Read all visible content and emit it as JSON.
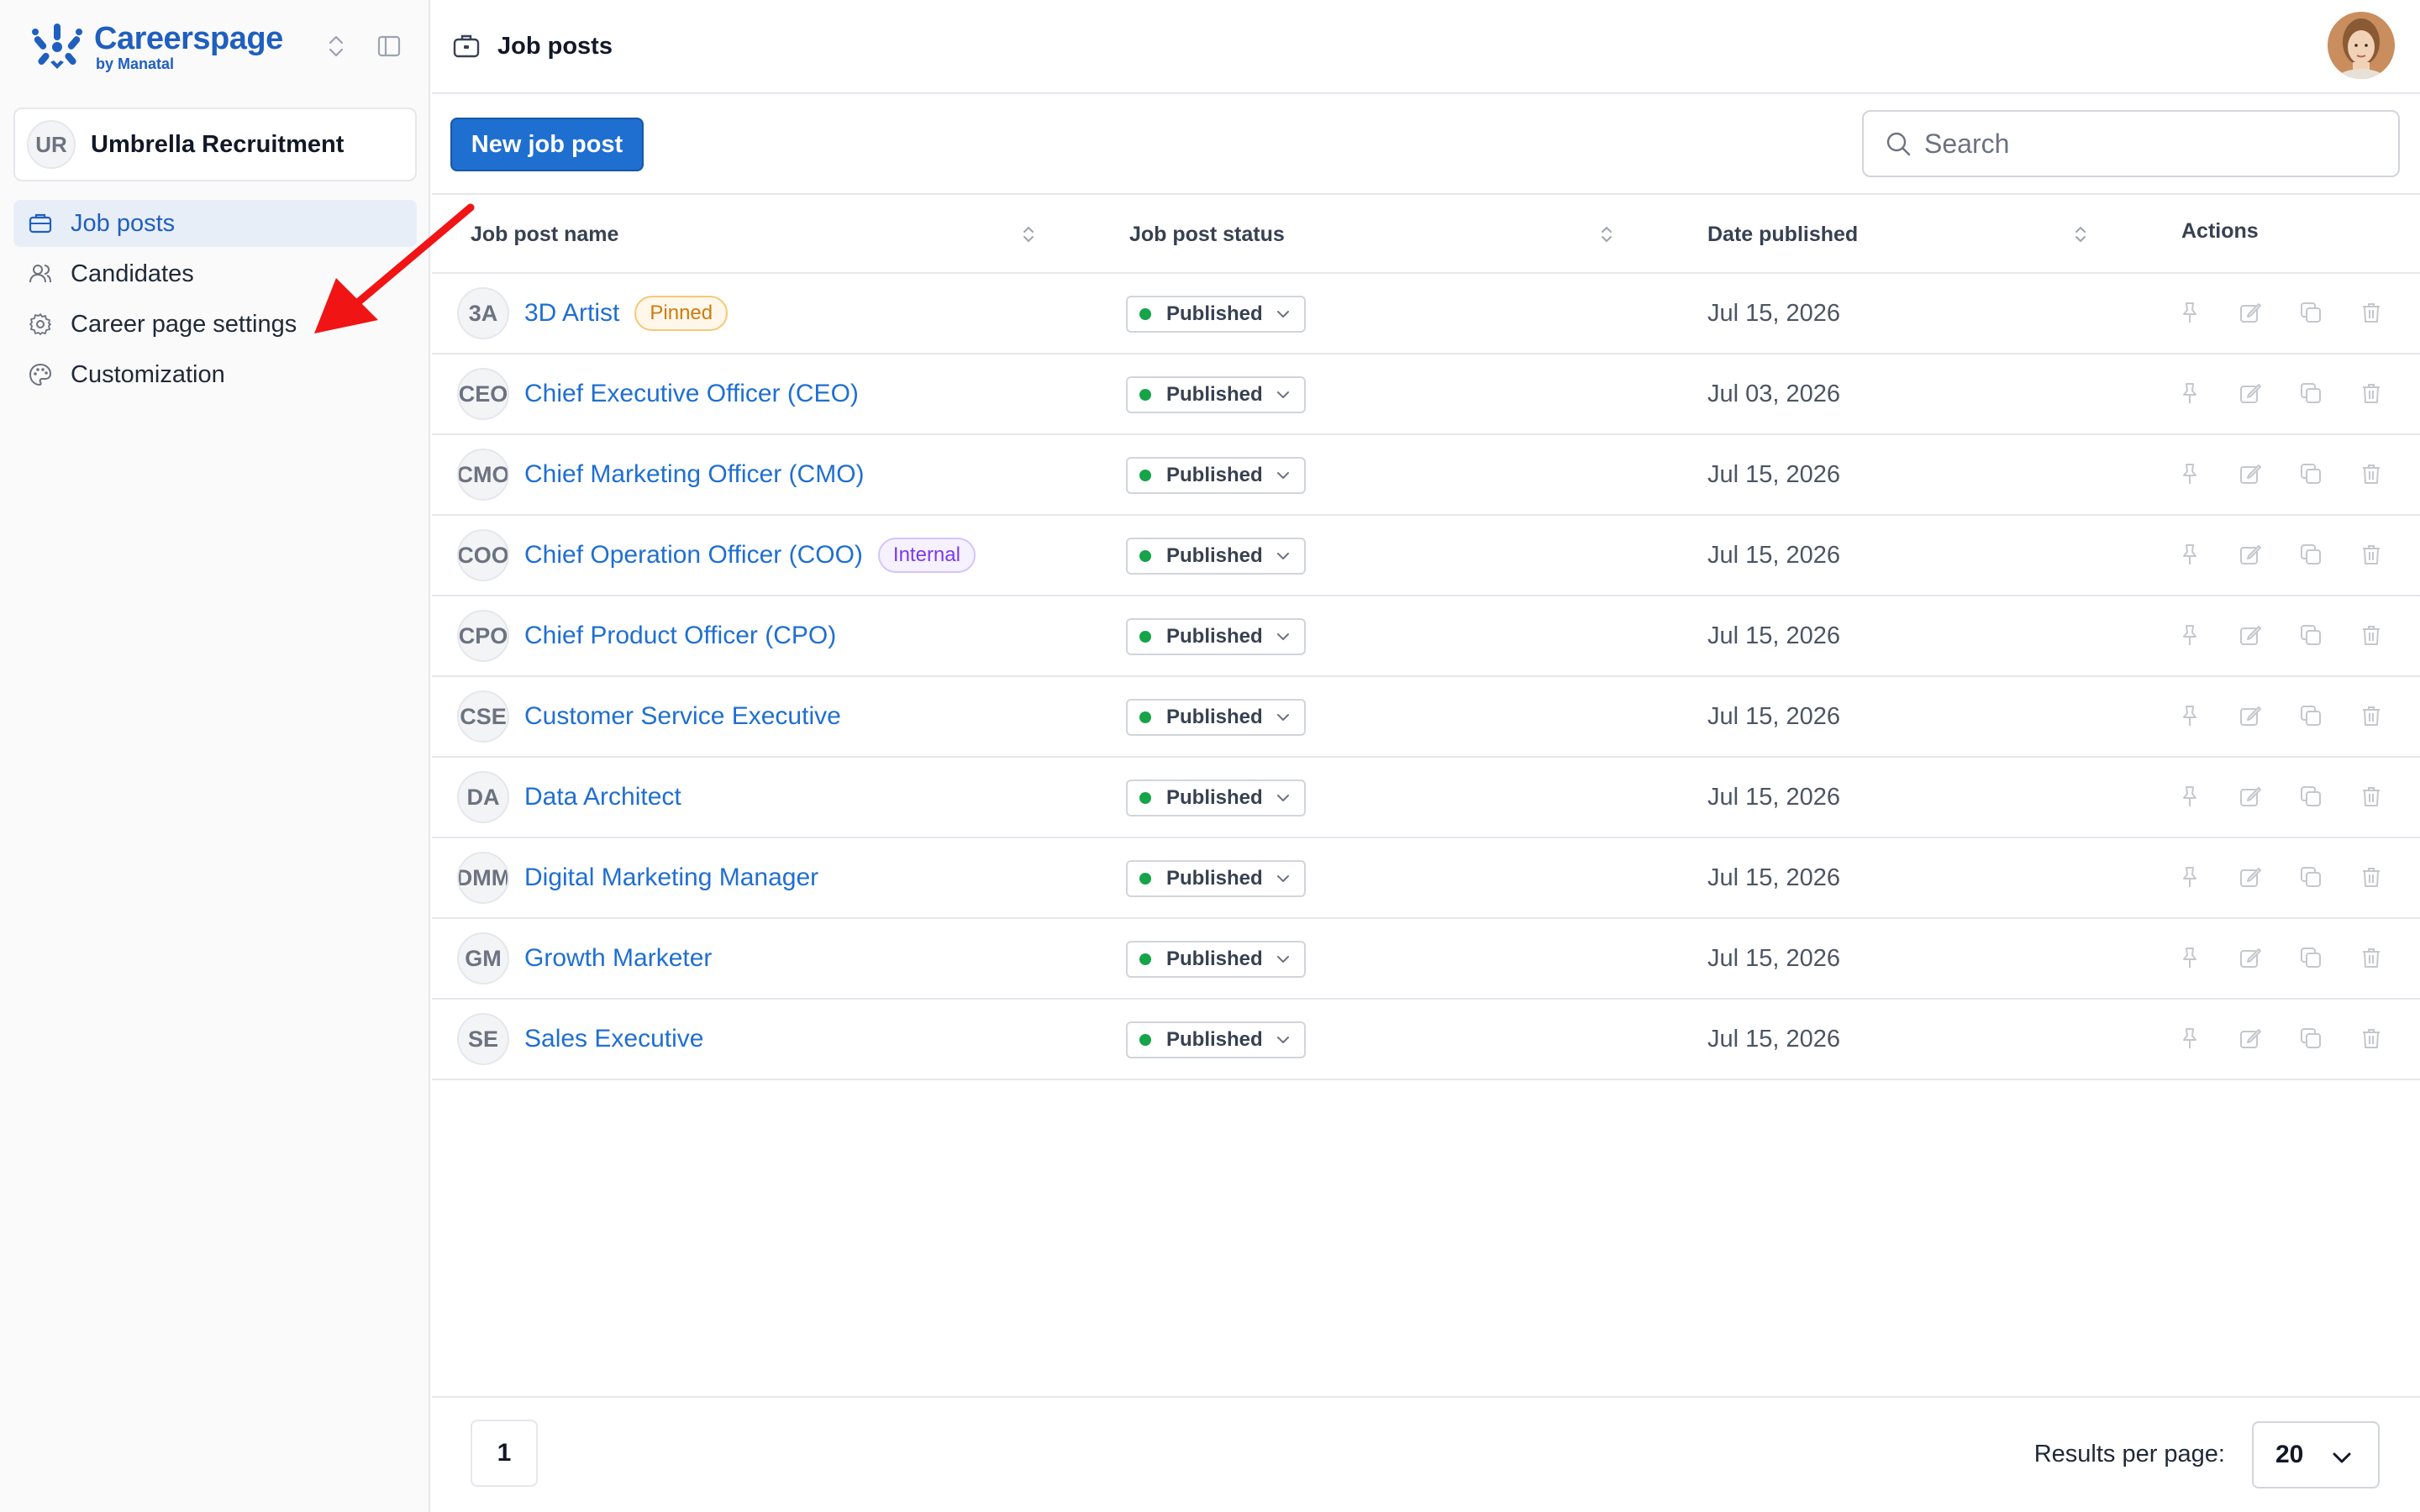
{
  "brand": {
    "name": "Careerspage",
    "sub": "by Manatal"
  },
  "organization": {
    "initials": "UR",
    "name": "Umbrella Recruitment"
  },
  "sidebar": {
    "items": [
      {
        "label": "Job posts",
        "icon": "briefcase-icon",
        "active": true
      },
      {
        "label": "Candidates",
        "icon": "users-icon",
        "active": false
      },
      {
        "label": "Career page settings",
        "icon": "gear-icon",
        "active": false
      },
      {
        "label": "Customization",
        "icon": "palette-icon",
        "active": false
      }
    ]
  },
  "header": {
    "title": "Job posts"
  },
  "toolbar": {
    "new_label": "New job post",
    "search_placeholder": "Search"
  },
  "table": {
    "columns": [
      "Job post name",
      "Job post status",
      "Date published",
      "Actions"
    ],
    "rows": [
      {
        "initials": "3A",
        "name": "3D Artist",
        "badge": "Pinned",
        "badge_type": "pinned",
        "status": "Published",
        "date": "Jul 15, 2026"
      },
      {
        "initials": "CEO",
        "name": "Chief Executive Officer (CEO)",
        "badge": "",
        "badge_type": "",
        "status": "Published",
        "date": "Jul 03, 2026"
      },
      {
        "initials": "CMO",
        "name": "Chief Marketing Officer (CMO)",
        "badge": "",
        "badge_type": "",
        "status": "Published",
        "date": "Jul 15, 2026"
      },
      {
        "initials": "COO",
        "name": "Chief Operation Officer (COO)",
        "badge": "Internal",
        "badge_type": "internal",
        "status": "Published",
        "date": "Jul 15, 2026"
      },
      {
        "initials": "CPO",
        "name": "Chief Product Officer (CPO)",
        "badge": "",
        "badge_type": "",
        "status": "Published",
        "date": "Jul 15, 2026"
      },
      {
        "initials": "CSE",
        "name": "Customer Service Executive",
        "badge": "",
        "badge_type": "",
        "status": "Published",
        "date": "Jul 15, 2026"
      },
      {
        "initials": "DA",
        "name": "Data Architect",
        "badge": "",
        "badge_type": "",
        "status": "Published",
        "date": "Jul 15, 2026"
      },
      {
        "initials": "DMM",
        "name": "Digital Marketing Manager",
        "badge": "",
        "badge_type": "",
        "status": "Published",
        "date": "Jul 15, 2026"
      },
      {
        "initials": "GM",
        "name": "Growth Marketer",
        "badge": "",
        "badge_type": "",
        "status": "Published",
        "date": "Jul 15, 2026"
      },
      {
        "initials": "SE",
        "name": "Sales Executive",
        "badge": "",
        "badge_type": "",
        "status": "Published",
        "date": "Jul 15, 2026"
      }
    ],
    "action_icons": [
      "pin-icon",
      "edit-icon",
      "duplicate-icon",
      "trash-icon"
    ]
  },
  "pagination": {
    "current_page": "1",
    "results_label": "Results per page:",
    "results_value": "20"
  },
  "colors": {
    "accent": "#1f6fd1",
    "brand": "#1f5fbf",
    "status_published": "#16a34a",
    "pinned": "#d07a0c",
    "internal": "#7c3aed",
    "annotation_arrow": "#f01414"
  }
}
